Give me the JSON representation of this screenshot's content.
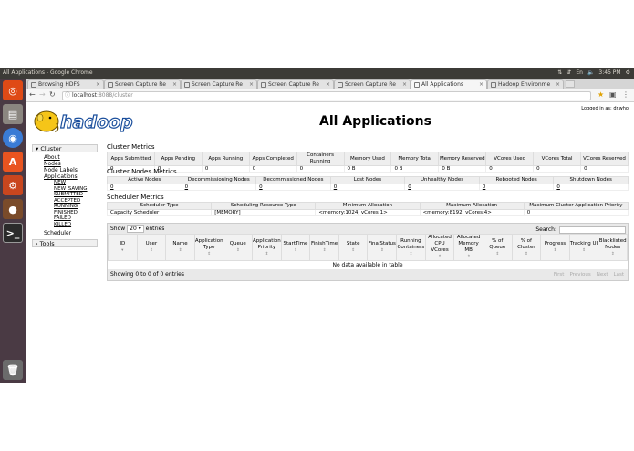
{
  "window": {
    "title": "All Applications - Google Chrome",
    "time": "3:45 PM"
  },
  "tabs": [
    {
      "label": "Browsing HDFS"
    },
    {
      "label": "Screen Capture Re"
    },
    {
      "label": "Screen Capture Re"
    },
    {
      "label": "Screen Capture Re"
    },
    {
      "label": "Screen Capture Re"
    },
    {
      "label": "All Applications"
    },
    {
      "label": "Hadoop Environme"
    }
  ],
  "url": {
    "host": "localhost",
    "rest": ":8088/cluster"
  },
  "page": {
    "title": "All Applications",
    "logged_in": "Logged in as: dr.who",
    "logo_text": "hadoop"
  },
  "sidenav": {
    "cluster": "Cluster",
    "items": [
      "About",
      "Nodes",
      "Node Labels",
      "Applications"
    ],
    "app_states": [
      "NEW",
      "NEW_SAVING",
      "SUBMITTED",
      "ACCEPTED",
      "RUNNING",
      "FINISHED",
      "FAILED",
      "KILLED"
    ],
    "scheduler": "Scheduler",
    "tools": "Tools"
  },
  "cluster_metrics": {
    "title": "Cluster Metrics",
    "headers": [
      "Apps Submitted",
      "Apps Pending",
      "Apps Running",
      "Apps Completed",
      "Containers Running",
      "Memory Used",
      "Memory Total",
      "Memory Reserved",
      "VCores Used",
      "VCores Total",
      "VCores Reserved"
    ],
    "values": [
      "0",
      "0",
      "0",
      "0",
      "0",
      "0 B",
      "0 B",
      "0 B",
      "0",
      "0",
      "0"
    ]
  },
  "nodes_metrics": {
    "title": "Cluster Nodes Metrics",
    "headers": [
      "Active Nodes",
      "Decommissioning Nodes",
      "Decommissioned Nodes",
      "Lost Nodes",
      "Unhealthy Nodes",
      "Rebooted Nodes",
      "Shutdown Nodes"
    ],
    "values": [
      "0",
      "0",
      "0",
      "0",
      "0",
      "0",
      "0"
    ]
  },
  "scheduler_metrics": {
    "title": "Scheduler Metrics",
    "headers": [
      "Scheduler Type",
      "Scheduling Resource Type",
      "Minimum Allocation",
      "Maximum Allocation",
      "Maximum Cluster Application Priority"
    ],
    "values": [
      "Capacity Scheduler",
      "[MEMORY]",
      "<memory:1024, vCores:1>",
      "<memory:8192, vCores:4>",
      "0"
    ]
  },
  "apps_table": {
    "show_label": "Show",
    "entries_count": "20",
    "entries_label": "entries",
    "search_label": "Search:",
    "columns": [
      "ID",
      "User",
      "Name",
      "Application Type",
      "Queue",
      "Application Priority",
      "StartTime",
      "FinishTime",
      "State",
      "FinalStatus",
      "Running Containers",
      "Allocated CPU VCores",
      "Allocated Memory MB",
      "% of Queue",
      "% of Cluster",
      "Progress",
      "Tracking UI",
      "Blacklisted Nodes"
    ],
    "empty": "No data available in table",
    "info": "Showing 0 to 0 of 0 entries",
    "pager": [
      "First",
      "Previous",
      "Next",
      "Last"
    ]
  }
}
